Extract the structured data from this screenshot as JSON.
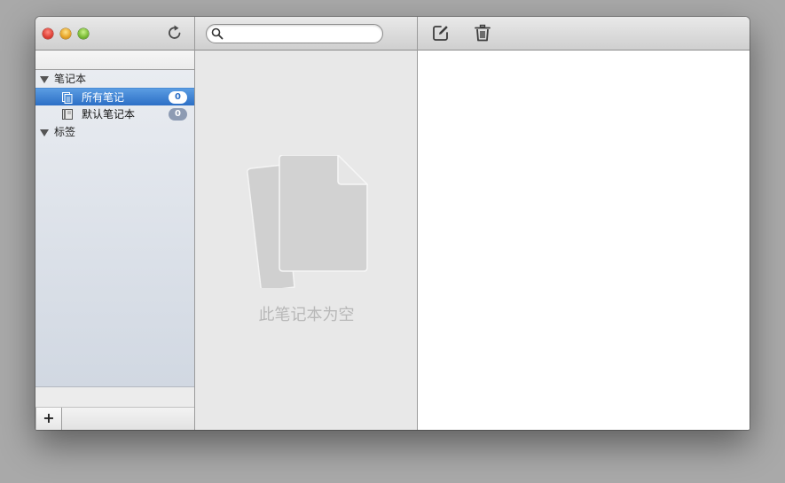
{
  "toolbar": {
    "search_placeholder": "",
    "search_value": ""
  },
  "sidebar": {
    "groups": [
      {
        "label": "笔记本"
      },
      {
        "label": "标签"
      }
    ],
    "notebooks": [
      {
        "label": "所有笔记",
        "count": "0",
        "icon": "all-notes-icon",
        "selected": true
      },
      {
        "label": "默认笔记本",
        "count": "0",
        "icon": "notebook-icon",
        "selected": false
      }
    ],
    "add_label": "+"
  },
  "notes": {
    "empty_message": "此笔记本为空"
  },
  "colors": {
    "selection": "#2c6fc6",
    "window_bg": "#a9a9a9"
  }
}
